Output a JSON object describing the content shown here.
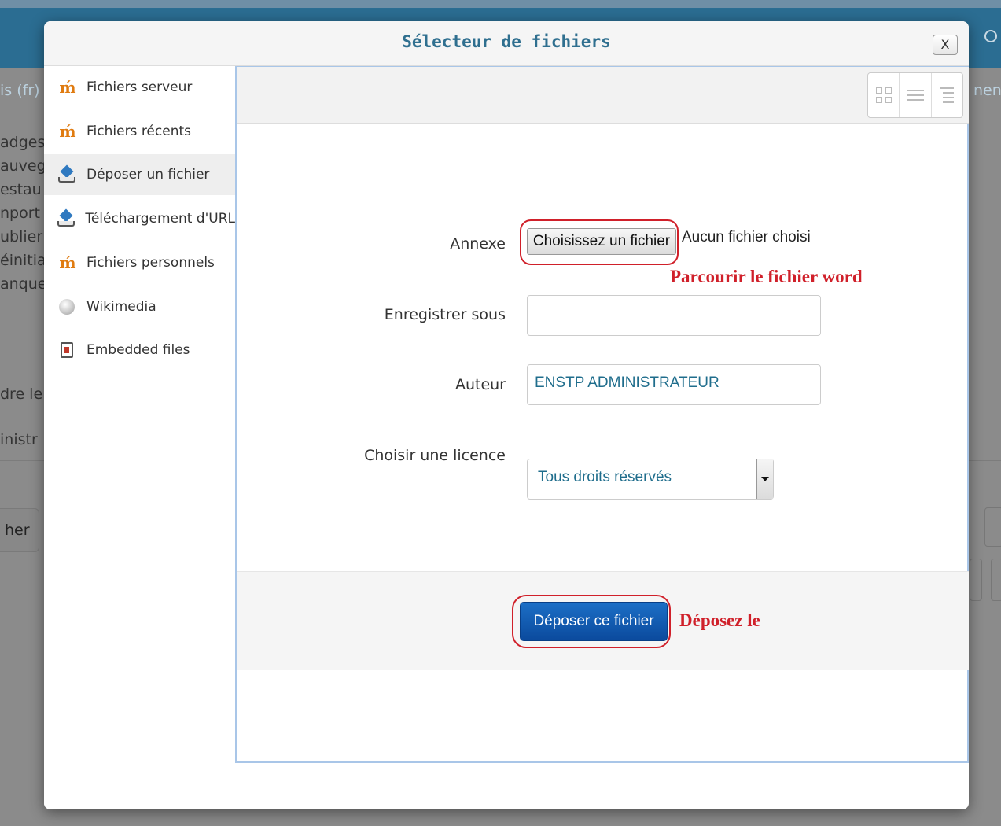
{
  "background": {
    "lang_label": "is (fr)",
    "right_label": "nen",
    "left_items": [
      "adges",
      "auveg",
      "estau",
      "nport",
      "ublier",
      "éinitia",
      "anque",
      "",
      "dre le",
      "",
      "inistr"
    ],
    "left_button": "her"
  },
  "dialog": {
    "title": "Sélecteur de fichiers",
    "close_label": "X"
  },
  "sidebar": {
    "items": [
      {
        "label": "Fichiers serveur",
        "icon": "moodle-icon"
      },
      {
        "label": "Fichiers récents",
        "icon": "moodle-icon"
      },
      {
        "label": "Déposer un fichier",
        "icon": "upload-icon",
        "active": true
      },
      {
        "label": "Téléchargement d'URL",
        "icon": "upload-icon"
      },
      {
        "label": "Fichiers personnels",
        "icon": "moodle-icon"
      },
      {
        "label": "Wikimedia",
        "icon": "wikimedia-icon"
      },
      {
        "label": "Embedded files",
        "icon": "document-icon"
      }
    ]
  },
  "form": {
    "attachment_label": "Annexe",
    "choose_file_button": "Choisissez un fichier",
    "file_status": "Aucun fichier choisi",
    "save_as_label": "Enregistrer sous",
    "save_as_value": "",
    "author_label": "Auteur",
    "author_value": "ENSTP ADMINISTRATEUR",
    "license_label": "Choisir une licence",
    "license_value": "Tous droits réservés",
    "upload_button": "Déposer ce fichier"
  },
  "annotations": {
    "browse": "Parcourir le fichier word",
    "drop": "Déposez le"
  },
  "colors": {
    "title": "#2f6f8f",
    "annotation": "#d0202a",
    "primary_button": "#0b4a9d",
    "input_text": "#1f6d8c"
  }
}
